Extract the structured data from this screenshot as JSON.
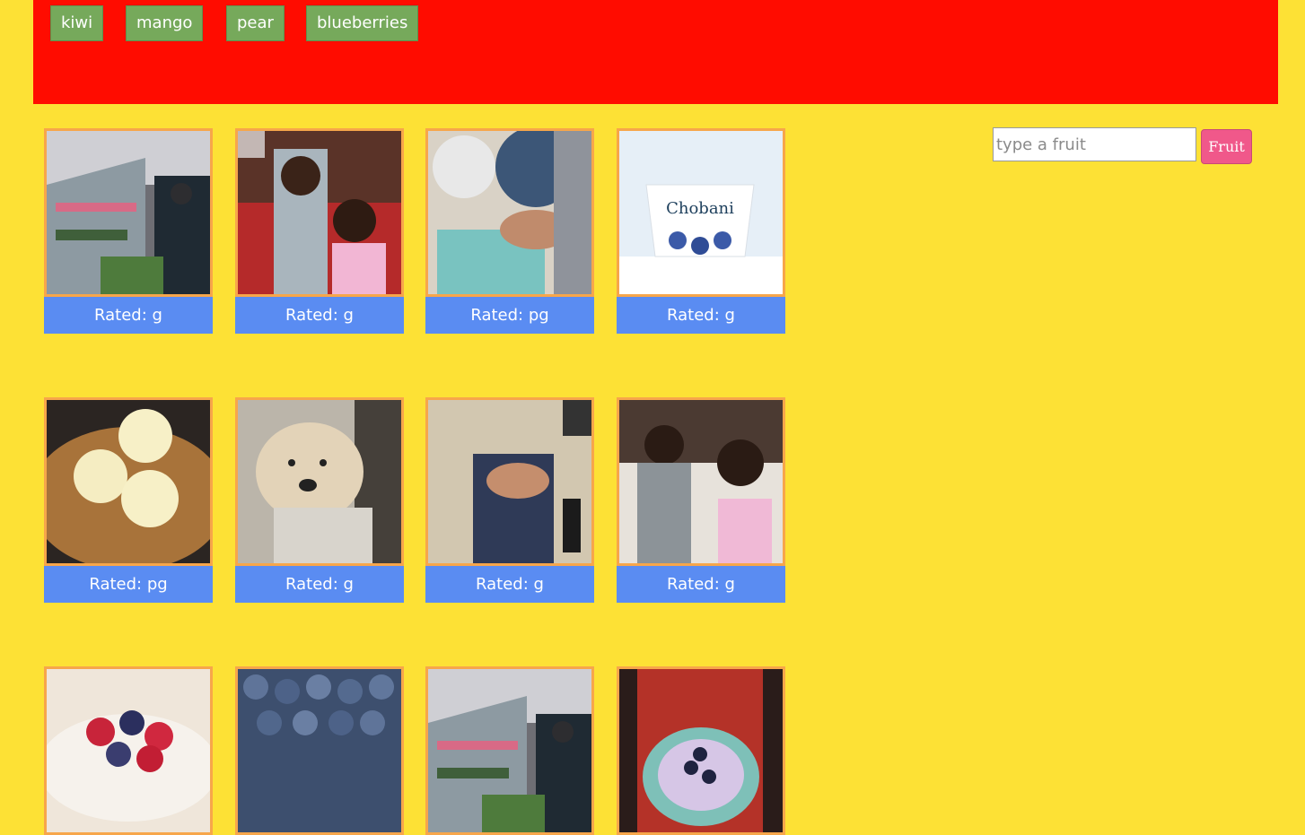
{
  "header": {
    "fruit_buttons": [
      {
        "label": "kiwi"
      },
      {
        "label": "mango"
      },
      {
        "label": "pear"
      },
      {
        "label": "blueberries"
      }
    ]
  },
  "search": {
    "placeholder": "type a fruit",
    "value": "",
    "button_label": "Fruit"
  },
  "gifs": [
    {
      "rating_label": "Rated: g",
      "subject": "grocery-store-aisle"
    },
    {
      "rating_label": "Rated: g",
      "subject": "kids-in-kitchen"
    },
    {
      "rating_label": "Rated: pg",
      "subject": "hand-picking-blueberries"
    },
    {
      "rating_label": "Rated: g",
      "subject": "blueberry-yogurt-cup"
    },
    {
      "rating_label": "Rated: pg",
      "subject": "cookie-skillet-ice-cream"
    },
    {
      "rating_label": "Rated: g",
      "subject": "dog-being-petted"
    },
    {
      "rating_label": "Rated: g",
      "subject": "hand-in-blueberry-container"
    },
    {
      "rating_label": "Rated: g",
      "subject": "kids-eating"
    },
    {
      "rating_label": "",
      "subject": "bowl-of-berries"
    },
    {
      "rating_label": "",
      "subject": "pile-of-blueberries"
    },
    {
      "rating_label": "",
      "subject": "grocery-store-aisle"
    },
    {
      "rating_label": "",
      "subject": "blueberry-smoothie-bowl"
    }
  ]
}
